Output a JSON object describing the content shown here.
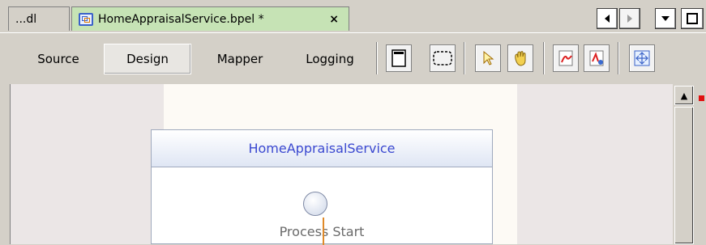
{
  "tabs": {
    "other_label": "...dl",
    "active_label": "HomeAppraisalService.bpel *",
    "close_glyph": "×",
    "active_color": "#c6e3b5"
  },
  "nav": {
    "left_icon": "scroll-left-icon",
    "right_icon": "scroll-right-icon",
    "menu_icon": "chevron-down-icon",
    "maximize_icon": "maximize-icon"
  },
  "toolbar": {
    "views": [
      "Source",
      "Design",
      "Mapper",
      "Logging"
    ],
    "selected_view": "Design",
    "tools": [
      "expand-panel-icon",
      "collapse-panel-icon",
      "select-cursor-icon",
      "hand-pan-icon",
      "pdf-export-icon",
      "pdf-print-icon",
      "fit-diagram-icon"
    ]
  },
  "diagram": {
    "process_name": "HomeAppraisalService",
    "start_label": "Process Start",
    "accent_color": "#e08a2a",
    "title_color": "#3a48d0"
  },
  "scrollbar": {
    "up_glyph": "▲"
  }
}
